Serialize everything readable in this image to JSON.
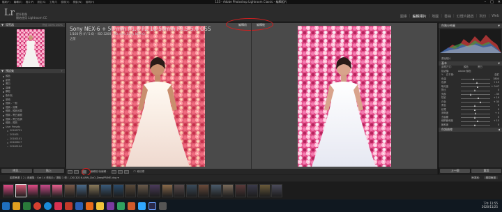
{
  "menubar": {
    "items": [
      "檔案(F)",
      "編輯(E)",
      "相片(P)",
      "設定(S)",
      "工具(T)",
      "檢視(V)",
      "視窗(W)",
      "說明(H)"
    ],
    "window_title": "133 - Adobe Photoshop Lightroom Classic - 編輯相片"
  },
  "identity": {
    "logo": "Lr",
    "line1": "提升影像",
    "line2": "開始使用 Lightroom CC"
  },
  "modules": [
    "圖庫",
    "編輯相片",
    "地圖",
    "書冊",
    "幻燈片播放",
    "列印",
    "Web"
  ],
  "left_panel": {
    "navigator_title": "導覽器",
    "navigator_zoom": "符合 100% 200%",
    "presets_title": "預設集",
    "preset_rows": [
      {
        "label": "顏色",
        "sub": false
      },
      {
        "label": "創意",
        "sub": false
      },
      {
        "label": "黑白",
        "sub": false
      },
      {
        "label": "曲線",
        "sub": false
      },
      {
        "label": "顆粒",
        "sub": false
      },
      {
        "label": "銳利化",
        "sub": false
      },
      {
        "label": "暈映",
        "sub": false
      },
      {
        "label": "經典 - 一般",
        "sub": false
      },
      {
        "label": "經典 - 效果",
        "sub": false
      },
      {
        "label": "經典 - 顏色效果",
        "sub": false
      },
      {
        "label": "經典 - 黑白濾鏡",
        "sub": false
      },
      {
        "label": "經典 - 黑白色調",
        "sub": false
      },
      {
        "label": "經典 - 視訊",
        "sub": false
      },
      {
        "label": "User Presets",
        "sub": false
      },
      {
        "label": "20180731",
        "sub": true
      },
      {
        "label": "201801",
        "sub": true
      },
      {
        "label": "20180101",
        "sub": true
      },
      {
        "label": "20180617",
        "sub": true
      },
      {
        "label": "20180104",
        "sub": true
      }
    ],
    "copy_button": "拷貝...",
    "paste_button": "貼上"
  },
  "center": {
    "camera_title": "Sony NEX-6 + 50 mm f/1.8 PZ 16-50mm F3.5-5.6 OSS",
    "exposure": "1/160 秒 (f / 5.6) - ISO 3200 - 50 mm (Sony NEX-6)",
    "state": "之前",
    "before_label": "編輯前",
    "after_label": "編輯後"
  },
  "toolbar": {
    "ba_label": "編輯前/後編輯 :",
    "soft_proof": "軟校樣"
  },
  "right_panel": {
    "histogram_title": "色階分佈圖",
    "original": "原始相片",
    "basic_title": "基本",
    "treatment": "處理方式:",
    "color": "顏色",
    "bw": "黑白",
    "profile": "描述檔:",
    "profile_value": "Adobe 顏色",
    "wb": "白平衡:",
    "wb_value": "自訂",
    "tone": "色調",
    "auto": "自動",
    "sliders": [
      {
        "label": "色溫",
        "value": "3800",
        "pos": 0.45
      },
      {
        "label": "色調",
        "value": "+ 15",
        "pos": 0.55
      },
      {
        "label": "曝光度",
        "value": "+ 0.47",
        "pos": 0.58
      },
      {
        "label": "對比",
        "value": "0",
        "pos": 0.5
      },
      {
        "label": "亮部",
        "value": "- 35",
        "pos": 0.35
      },
      {
        "label": "陰影",
        "value": "+ 19",
        "pos": 0.6
      },
      {
        "label": "白色",
        "value": "+ 35",
        "pos": 0.68
      },
      {
        "label": "黑色",
        "value": "0",
        "pos": 0.5
      },
      {
        "label": "紋理",
        "value": "0",
        "pos": 0.5
      },
      {
        "label": "清晰度",
        "value": "+ 4",
        "pos": 0.52
      },
      {
        "label": "去朦朧",
        "value": "0",
        "pos": 0.5
      },
      {
        "label": "細節飽和度",
        "value": "+ 15",
        "pos": 0.58
      },
      {
        "label": "飽和度",
        "value": "0",
        "pos": 0.5
      }
    ],
    "presence": "外觀",
    "tone_curve": "色調曲線",
    "prev_button": "上一個",
    "reset_button": "重設"
  },
  "filmstrip": {
    "info": "圖庫篩選 1 2 | 收藏集 : Gat 14 張相片 / 選取 1 張 / _DSC8216-ARW_DxO_DeepPRIME.dng ▾",
    "filter_label": "篩選器：",
    "filter_value": "關閉篩選"
  },
  "taskbar": {
    "time": "下午 11:55",
    "date": "2020/11/25"
  }
}
